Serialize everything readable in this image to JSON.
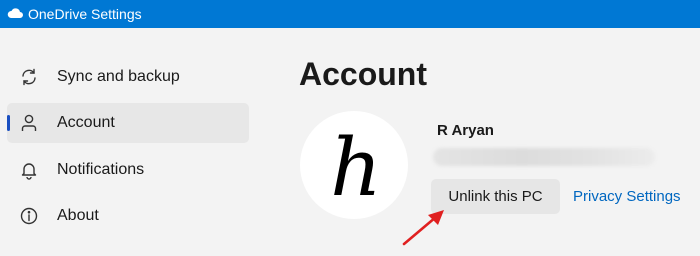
{
  "window": {
    "title": "OneDrive Settings",
    "icon": "cloud-icon"
  },
  "sidebar": {
    "items": [
      {
        "label": "Sync and backup",
        "icon": "sync-icon",
        "selected": false
      },
      {
        "label": "Account",
        "icon": "person-icon",
        "selected": true
      },
      {
        "label": "Notifications",
        "icon": "bell-icon",
        "selected": false
      },
      {
        "label": "About",
        "icon": "info-icon",
        "selected": false
      }
    ]
  },
  "main": {
    "title": "Account",
    "user_name": "R Aryan",
    "avatar_letter": "h",
    "unlink_label": "Unlink this PC",
    "privacy_label": "Privacy Settings"
  },
  "colors": {
    "titlebar": "#0078d4",
    "accent": "#1a4fc1",
    "link": "#0067c0",
    "annotation_arrow": "#e02020"
  }
}
